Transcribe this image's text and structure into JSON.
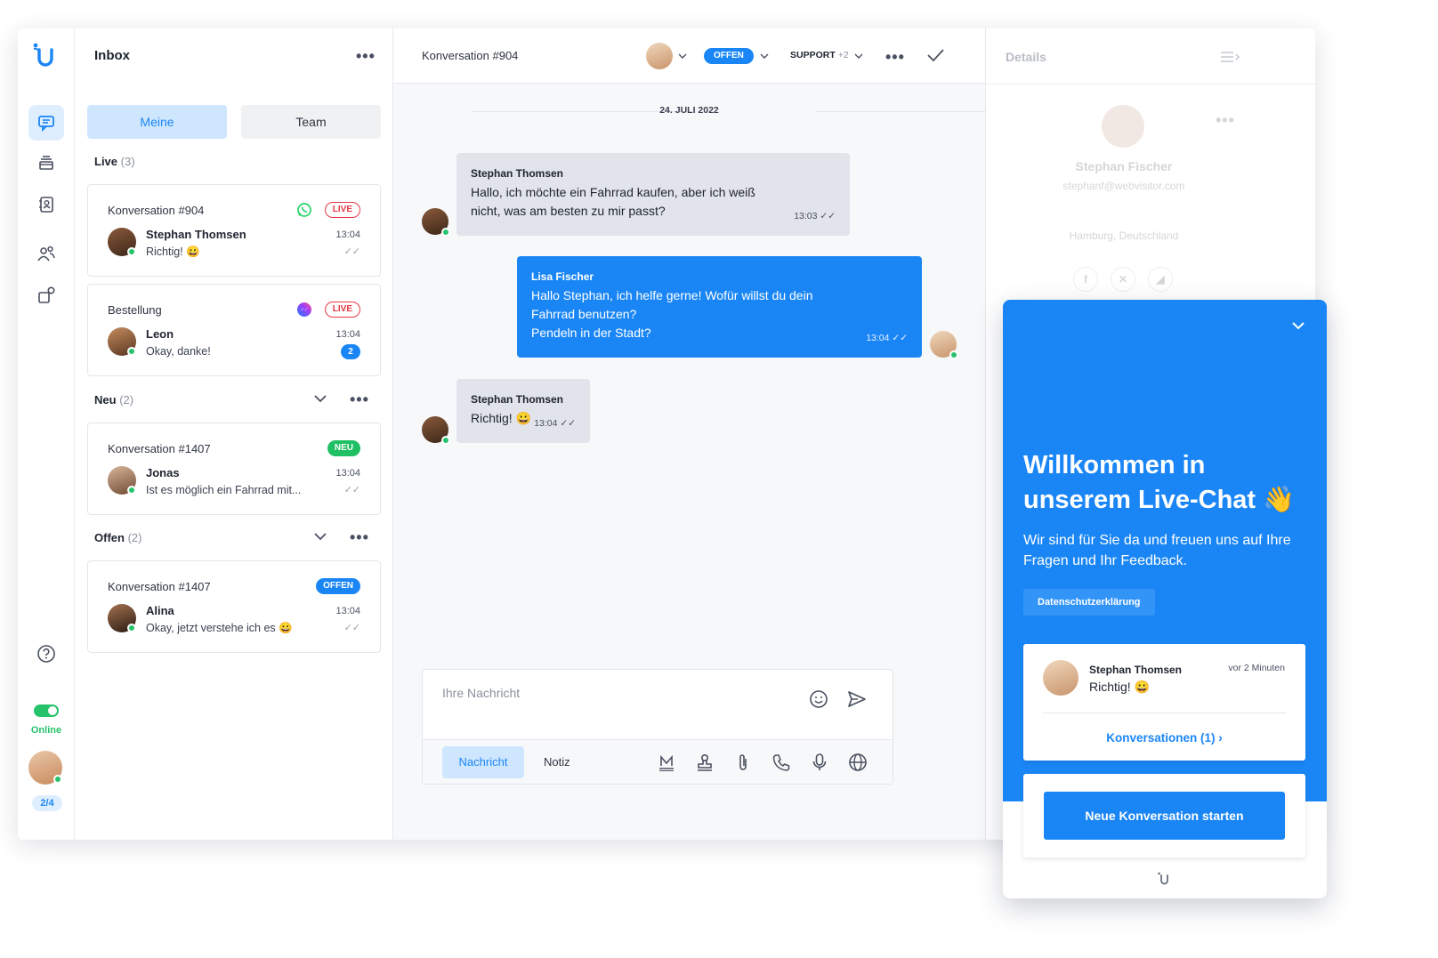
{
  "inbox": {
    "title": "Inbox",
    "tabs": {
      "mine": "Meine",
      "team": "Team"
    },
    "sections": {
      "live": {
        "label": "Live",
        "count": "(3)"
      },
      "neu": {
        "label": "Neu",
        "count": "(2)"
      },
      "offen": {
        "label": "Offen",
        "count": "(2)"
      }
    },
    "conversations": [
      {
        "title": "Konversation #904",
        "badge": "LIVE",
        "channel": "whatsapp-icon",
        "name": "Stephan Thomsen",
        "message": "Richtig! 😀",
        "time": "13:04"
      },
      {
        "title": "Bestellung",
        "badge": "LIVE",
        "channel": "messenger-icon",
        "name": "Leon",
        "message": "Okay, danke!",
        "time": "13:04",
        "unread": "2"
      },
      {
        "title": "Konversation #1407",
        "badge": "NEU",
        "name": "Jonas",
        "message": "Ist es möglich ein Fahrrad mit...",
        "time": "13:04"
      },
      {
        "title": "Konversation #1407",
        "badge": "OFFEN",
        "name": "Alina",
        "message": "Okay, jetzt verstehe ich es 😀",
        "time": "13:04"
      }
    ]
  },
  "rail": {
    "status": "Online",
    "pager": "2/4"
  },
  "chat": {
    "title": "Konversation #904",
    "status": "OFFEN",
    "team": "SUPPORT",
    "team_extra": "+2",
    "date": "24. JULI 2022",
    "messages": [
      {
        "author": "Stephan Thomsen",
        "text": "Hallo, ich möchte ein Fahrrad kaufen, aber ich weiß nicht, was am besten zu mir passt?",
        "time": "13:03"
      },
      {
        "author": "Lisa Fischer",
        "text_lines": [
          "Hallo Stephan, ich helfe gerne! Wofür willst du dein",
          "Fahrrad benutzen?",
          "Pendeln in der Stadt?"
        ],
        "time": "13:04"
      },
      {
        "author": "Stephan Thomsen",
        "text": "Richtig! 😀",
        "time": "13:04"
      }
    ],
    "composer": {
      "placeholder": "Ihre Nachricht",
      "tab_message": "Nachricht",
      "tab_note": "Notiz"
    }
  },
  "details": {
    "title": "Details",
    "name": "Stephan Fischer",
    "email": "stephanf@webvisitor.com",
    "location": "Hamburg, Deutschland"
  },
  "widget": {
    "title": "Willkommen in unserem Live-Chat 👋",
    "subtitle": "Wir sind für Sie da und freuen uns auf Ihre Fragen und Ihr Feedback.",
    "privacy": "Datenschutzerklärung",
    "last_author": "Stephan Thomsen",
    "last_time": "vor 2 Minuten",
    "last_message": "Richtig! 😀",
    "conversations_link": "Konversationen (1)",
    "new_conversation": "Neue Konversation starten"
  },
  "colors": {
    "accent": "#1a86f5",
    "online": "#27c26c",
    "live": "#e63946"
  }
}
